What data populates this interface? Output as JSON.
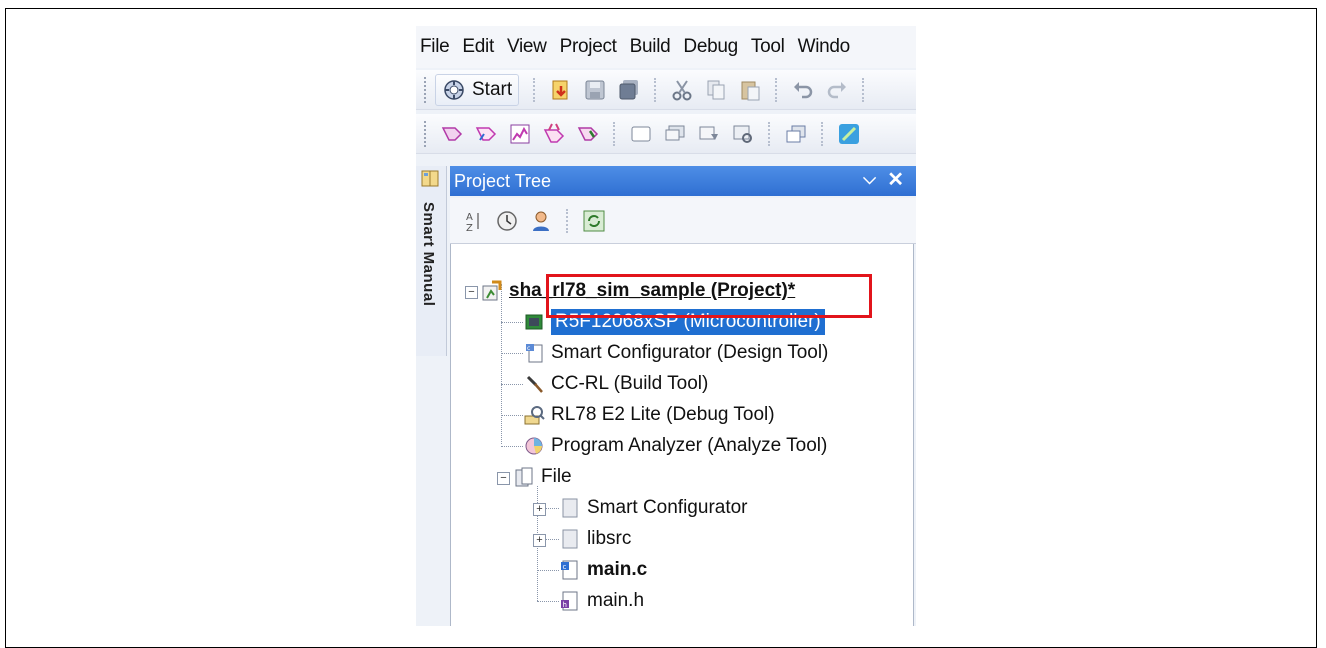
{
  "menu": [
    "File",
    "Edit",
    "View",
    "Project",
    "Build",
    "Debug",
    "Tool",
    "Windo"
  ],
  "toolbar": {
    "start_label": "Start"
  },
  "side_tab": {
    "label": "Smart Manual"
  },
  "panel": {
    "title": "Project Tree",
    "pin_glyph": "⌵",
    "close_glyph": "✕"
  },
  "tree": {
    "project": "sha_rl78_sim_sample (Project)*",
    "microcontroller": "R5F12068xSP (Microcontroller)",
    "smart_configurator_tool": "Smart Configurator (Design Tool)",
    "build_tool": "CC-RL (Build Tool)",
    "debug_tool": "RL78 E2 Lite (Debug Tool)",
    "analyze_tool": "Program Analyzer (Analyze Tool)",
    "file_folder": "File",
    "folder_smart_configurator": "Smart Configurator",
    "folder_libsrc": "libsrc",
    "file_main_c": "main.c",
    "file_main_h": "main.h"
  },
  "colors": {
    "selection": "#1f6fd1",
    "highlight_box": "#e2141b",
    "title_bar": "#3a7bdc"
  }
}
